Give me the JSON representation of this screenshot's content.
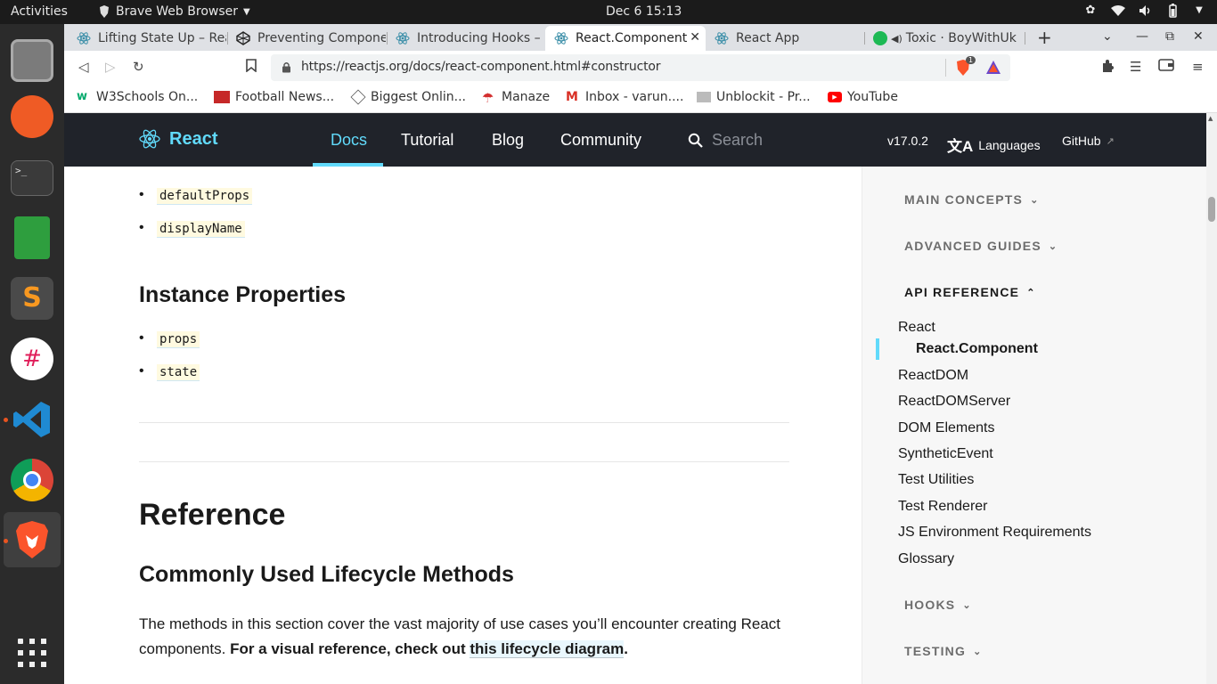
{
  "os": {
    "activities": "Activities",
    "app_name": "Brave Web Browser",
    "clock": "Dec 6  15:13"
  },
  "tabs": [
    {
      "title": "Lifting State Up – Rea"
    },
    {
      "title": "Preventing Compone"
    },
    {
      "title": "Introducing Hooks –"
    },
    {
      "title": "React.Component"
    },
    {
      "title": "React App"
    },
    {
      "title": "Toxic · BoyWithUk"
    }
  ],
  "address_bar": {
    "url": "https://reactjs.org/docs/react-component.html#constructor",
    "shields_count": "1"
  },
  "bookmarks": [
    {
      "label": "W3Schools On..."
    },
    {
      "label": "Football News..."
    },
    {
      "label": "Biggest Onlin..."
    },
    {
      "label": "Manaze"
    },
    {
      "label": "Inbox - varun...."
    },
    {
      "label": "Unblockit - Pr..."
    },
    {
      "label": "YouTube"
    }
  ],
  "react_header": {
    "logo": "React",
    "nav": [
      "Docs",
      "Tutorial",
      "Blog",
      "Community"
    ],
    "search_placeholder": "Search",
    "version": "v17.0.2",
    "languages": "Languages",
    "github": "GitHub"
  },
  "content": {
    "class_props": [
      "defaultProps",
      "displayName"
    ],
    "instance_heading": "Instance Properties",
    "instance_props": [
      "props",
      "state"
    ],
    "reference_heading": "Reference",
    "lifecycle_heading": "Commonly Used Lifecycle Methods",
    "para_plain": "The methods in this section cover the vast majority of use cases you’ll encounter creating React components. ",
    "para_bold": "For a visual reference, check out ",
    "para_link": "this lifecycle diagram",
    "para_end": "."
  },
  "sidebar": {
    "sections": [
      "MAIN CONCEPTS",
      "ADVANCED GUIDES",
      "API REFERENCE",
      "HOOKS",
      "TESTING"
    ],
    "api_items": [
      "React",
      "React.Component",
      "ReactDOM",
      "ReactDOMServer",
      "DOM Elements",
      "SyntheticEvent",
      "Test Utilities",
      "Test Renderer",
      "JS Environment Requirements",
      "Glossary"
    ]
  },
  "colors": {
    "react_blue": "#61dafb",
    "header_bg": "#20232a",
    "ubuntu_orange": "#e95420"
  }
}
